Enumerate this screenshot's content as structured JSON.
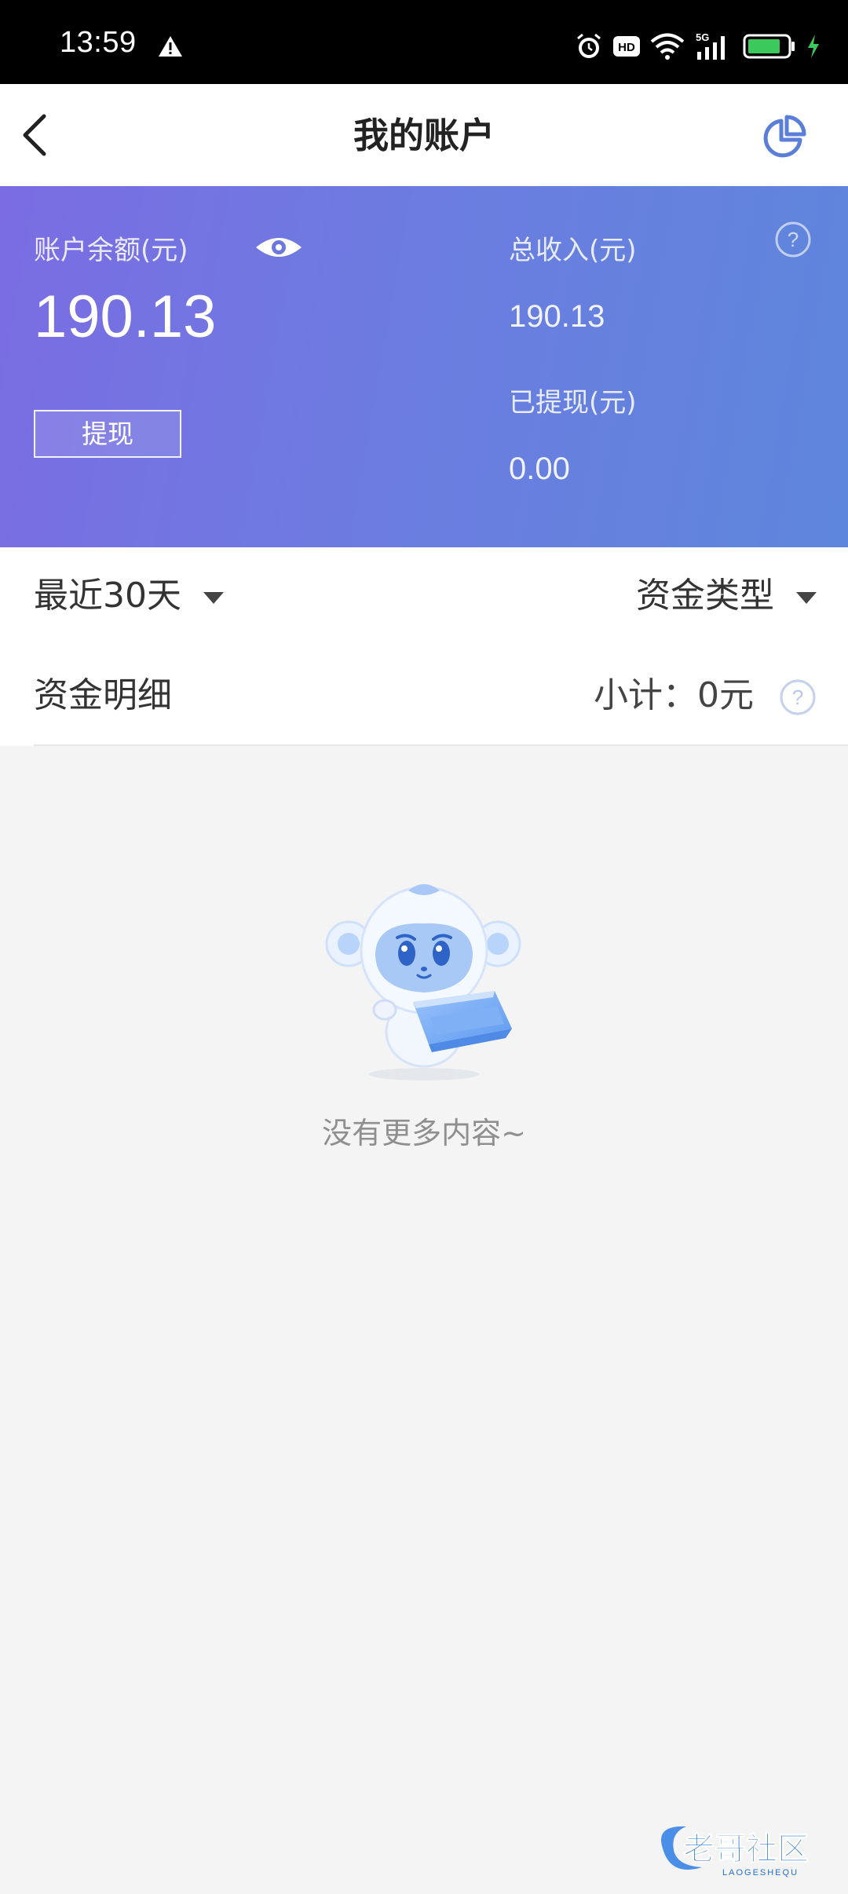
{
  "status_bar": {
    "time": "13:59",
    "icons": [
      "warning-icon",
      "alarm-icon",
      "hd-icon",
      "wifi-icon",
      "5g-signal-icon",
      "battery-icon",
      "charging-icon"
    ],
    "battery_color": "#3cc95c"
  },
  "header": {
    "title": "我的账户",
    "back_icon": "chevron-left-icon",
    "right_icon": "pie-chart-icon",
    "accent": "#5b7fd8"
  },
  "card": {
    "balance_label": "账户余额(元)",
    "balance_value": "190.13",
    "withdraw_label": "提现",
    "income_label": "总收入(元)",
    "income_value": "190.13",
    "withdrawn_label": "已提现(元)",
    "withdrawn_value": "0.00",
    "gradient_start": "#7b6ce3",
    "gradient_end": "#5e86dc"
  },
  "filters": {
    "period": "最近30天",
    "type": "资金类型"
  },
  "details": {
    "title": "资金明细",
    "subtotal": "小计：0元"
  },
  "empty_state": {
    "message": "没有更多内容~",
    "illustration": "monkey-mascot-empty-box"
  },
  "watermark": {
    "text": "老哥社区",
    "subtext": "LAOGESHEQU"
  }
}
